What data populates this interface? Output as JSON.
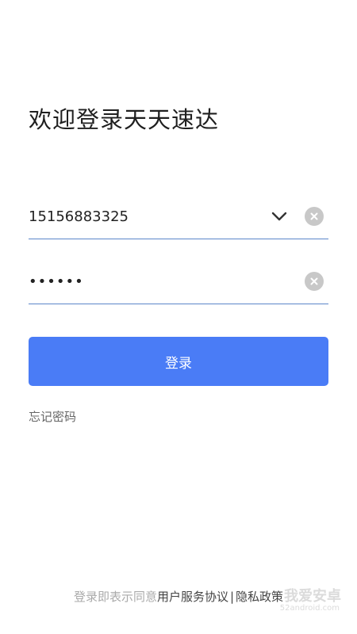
{
  "page": {
    "title": "欢迎登录天天速达"
  },
  "form": {
    "phone_value": "15156883325",
    "password_value": "••••••",
    "login_label": "登录",
    "forgot_label": "忘记密码"
  },
  "agreement": {
    "prefix": "登录即表示同意",
    "terms_label": "用户服务协议",
    "separator": "|",
    "privacy_label": "隐私政策"
  },
  "watermark": {
    "brand": "我爱安卓",
    "site": "52android.com"
  },
  "colors": {
    "accent": "#4a7cf6",
    "underline": "#5b86c9",
    "clear_bg": "#c8c8c8"
  },
  "icons": {
    "dropdown": "chevron-down-icon",
    "clear": "clear-circle-icon"
  }
}
